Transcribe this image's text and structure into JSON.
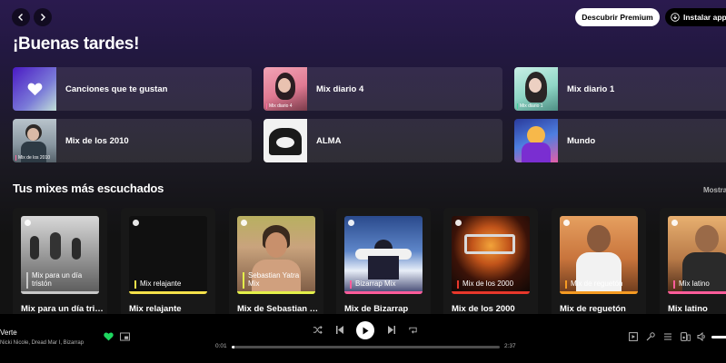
{
  "header": {
    "premium_label": "Descubrir Premium",
    "install_label": "Instalar app"
  },
  "greeting": "¡Buenas tardes!",
  "shortcuts": [
    {
      "label": "Canciones que te gustan",
      "tag": ""
    },
    {
      "label": "Mix diario 4",
      "tag": "Mix diario 4"
    },
    {
      "label": "Mix diario 1",
      "tag": "Mix diario 1"
    },
    {
      "label": "Mix de los 2010",
      "tag": "Mix de los 2010"
    },
    {
      "label": "ALMA",
      "tag": ""
    },
    {
      "label": "Mundo",
      "tag": ""
    }
  ],
  "mixes_section": {
    "title": "Tus mixes más escuchados",
    "show_all": "Mostrar todo",
    "cards": [
      {
        "cover_label": "Mix para un día tristón",
        "title": "Mix para un día tristón",
        "accent": "#c8c8c8"
      },
      {
        "cover_label": "Mix relajante",
        "title": "Mix relajante",
        "accent": "#f5e14a"
      },
      {
        "cover_label": "Sebastian Yatra Mix",
        "title": "Mix de Sebastian Yatra",
        "accent": "#e3f04a"
      },
      {
        "cover_label": "Bizarrap Mix",
        "title": "Mix de Bizarrap",
        "accent": "#ff5c9a"
      },
      {
        "cover_label": "Mix de los 2000",
        "title": "Mix de los 2000",
        "accent": "#e8372b"
      },
      {
        "cover_label": "Mix de reguetón",
        "title": "Mix de reguetón",
        "accent": "#f59b23"
      },
      {
        "cover_label": "Mix latino",
        "title": "Mix latino",
        "accent": "#ff5c9a"
      }
    ]
  },
  "player": {
    "track_title": "Verte",
    "artists": "Nicki Nicole, Dread Mar I, Bizarrap",
    "elapsed": "0:01",
    "duration": "2:37",
    "progress_fraction": 0.01,
    "liked": true,
    "volume_fraction": 1.0
  },
  "colors": {
    "accent_green": "#1ed760",
    "background": "#121212"
  }
}
